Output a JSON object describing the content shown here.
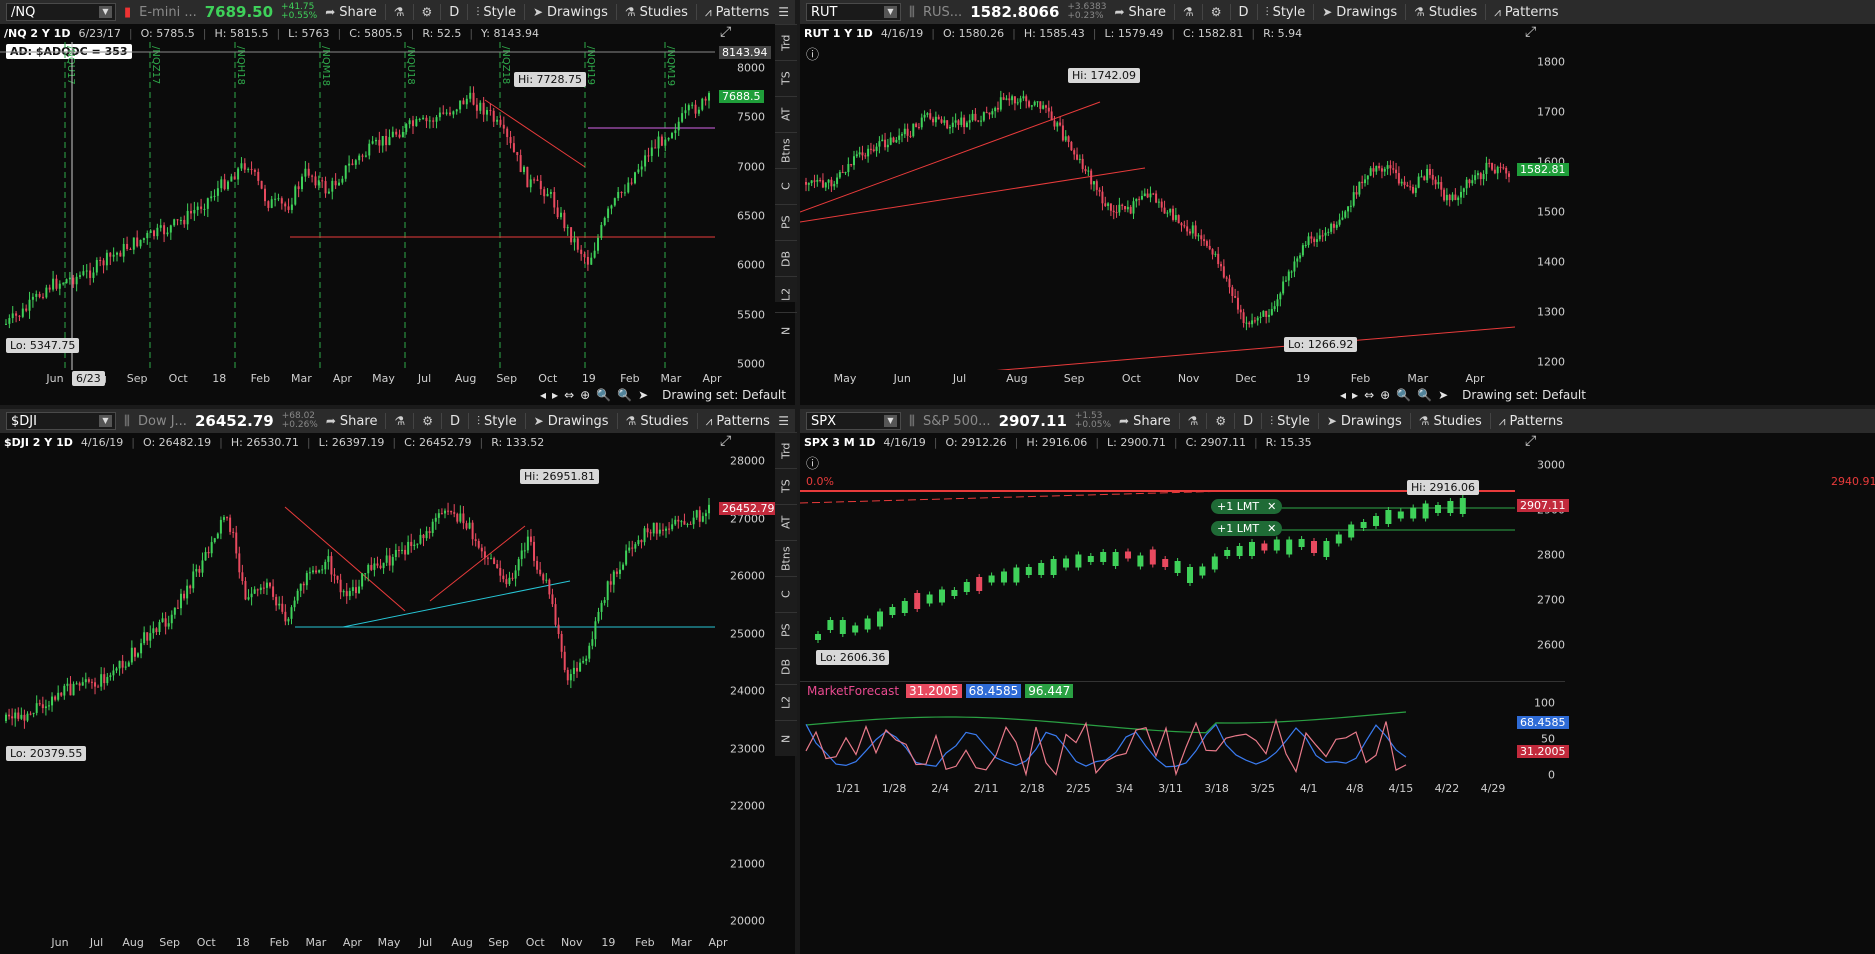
{
  "colors": {
    "up": "#3fd15a",
    "down": "#e84a5f",
    "trend": "#e83b3b",
    "cyan": "#27c6d6",
    "magenta": "#d565e8",
    "blue": "#2e6bd6"
  },
  "toolbar": {
    "share": "Share",
    "period": "D",
    "style": "Style",
    "drawings": "Drawings",
    "studies": "Studies",
    "patterns": "Patterns"
  },
  "sidebar": [
    "Trd",
    "TS",
    "AT",
    "Btns",
    "C",
    "PS",
    "DB",
    "L2",
    "N"
  ],
  "drawing_set": "Drawing set: Default",
  "panels": {
    "nq": {
      "symbol": "/NQ",
      "desc": "E-mini ...",
      "last": "7689.50",
      "chg1": "+41.75",
      "chg2": "+0.55%",
      "info": {
        "ticker": "/NQ 2 Y 1D",
        "date": "6/23/17",
        "o": "O: 5785.5",
        "h": "H: 5815.5",
        "l": "L: 5763",
        "c": "C: 5805.5",
        "r": "R: 52.5",
        "y": "Y: 8143.94"
      },
      "study_label": "AD: $ADQDC = 353",
      "hi": "Hi: 7728.75",
      "lo": "Lo: 5347.75",
      "last_tag": "7688.5",
      "y_tag": "8143.94",
      "cursor_date": "6/23",
      "expiries": [
        "/NQU17",
        "/NQZ17",
        "/NQH18",
        "/NQM18",
        "/NQU18",
        "/NQZ18",
        "/NQH19",
        "/NQM19"
      ],
      "yticks": [
        "8000",
        "7500",
        "7000",
        "6500",
        "6000",
        "5500",
        "5000"
      ],
      "xticks": [
        "Jun",
        "Aug",
        "Sep",
        "Oct",
        "18",
        "Feb",
        "Mar",
        "Apr",
        "May",
        "Jul",
        "Aug",
        "Sep",
        "Oct",
        "19",
        "Feb",
        "Mar",
        "Apr"
      ]
    },
    "rut": {
      "symbol": "RUT",
      "desc": "RUS...",
      "last": "1582.8066",
      "chg1": "+3.6383",
      "chg2": "+0.23%",
      "info": {
        "ticker": "RUT 1 Y 1D",
        "date": "4/16/19",
        "o": "O: 1580.26",
        "h": "H: 1585.43",
        "l": "L: 1579.49",
        "c": "C: 1582.81",
        "r": "R: 5.94"
      },
      "hi": "Hi: 1742.09",
      "lo": "Lo: 1266.92",
      "last_tag": "1582.81",
      "yticks": [
        "1800",
        "1700",
        "1600",
        "1500",
        "1400",
        "1300",
        "1200"
      ],
      "xticks": [
        "May",
        "Jun",
        "Jul",
        "Aug",
        "Sep",
        "Oct",
        "Nov",
        "Dec",
        "19",
        "Feb",
        "Mar",
        "Apr"
      ]
    },
    "dji": {
      "symbol": "$DJI",
      "desc": "Dow J...",
      "last": "26452.79",
      "chg1": "+68.02",
      "chg2": "+0.26%",
      "info": {
        "ticker": "$DJI 2 Y 1D",
        "date": "4/16/19",
        "o": "O: 26482.19",
        "h": "H: 26530.71",
        "l": "L: 26397.19",
        "c": "C: 26452.79",
        "r": "R: 133.52"
      },
      "hi": "Hi: 26951.81",
      "lo": "Lo: 20379.55",
      "last_tag": "26452.79",
      "yticks": [
        "28000",
        "27000",
        "26000",
        "25000",
        "24000",
        "23000",
        "22000",
        "21000",
        "20000"
      ],
      "xticks": [
        "Jun",
        "Jul",
        "Aug",
        "Sep",
        "Oct",
        "18",
        "Feb",
        "Mar",
        "Apr",
        "May",
        "Jul",
        "Aug",
        "Sep",
        "Oct",
        "Nov",
        "19",
        "Feb",
        "Mar",
        "Apr"
      ]
    },
    "spx": {
      "symbol": "SPX",
      "desc": "S&P 500...",
      "last": "2907.11",
      "chg1": "+1.53",
      "chg2": "+0.05%",
      "info": {
        "ticker": "SPX 3 M 1D",
        "date": "4/16/19",
        "o": "O: 2912.26",
        "h": "H: 2916.06",
        "l": "L: 2900.71",
        "c": "C: 2907.11",
        "r": "R: 15.35"
      },
      "hi": "Hi: 2916.06",
      "lo": "Lo: 2606.36",
      "last_tag": "2907.11",
      "fib_label": "0.0%",
      "fib_price": "2940.91",
      "orders": [
        "+1 LMT",
        "+1 LMT"
      ],
      "yticks": [
        "3000",
        "2900",
        "2800",
        "2700",
        "2600"
      ],
      "study": {
        "name": "MarketForecast",
        "v1": "31.2005",
        "v2": "68.4585",
        "v3": "96.447",
        "tag_blue": "68.4585",
        "tag_red": "31.2005",
        "yticks": [
          "100",
          "50",
          "0"
        ]
      },
      "xticks": [
        "1/21",
        "1/28",
        "2/4",
        "2/11",
        "2/18",
        "2/25",
        "3/4",
        "3/11",
        "3/18",
        "3/25",
        "4/1",
        "4/8",
        "4/15",
        "4/22",
        "4/29"
      ]
    }
  }
}
